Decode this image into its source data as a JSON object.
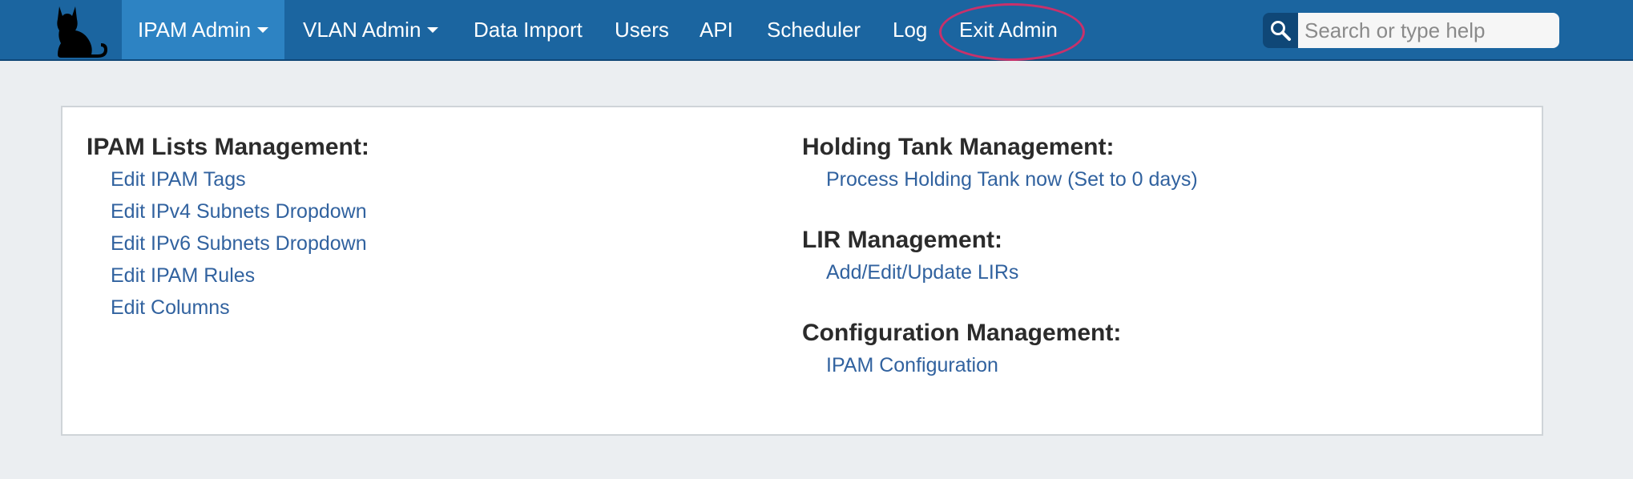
{
  "nav": {
    "items": [
      {
        "label": "IPAM Admin",
        "dropdown": true,
        "active": true
      },
      {
        "label": "VLAN Admin",
        "dropdown": true
      },
      {
        "label": "Data Import"
      },
      {
        "label": "Users"
      },
      {
        "label": "API"
      },
      {
        "label": "Scheduler"
      },
      {
        "label": "Log"
      },
      {
        "label": "Exit Admin",
        "highlighted": true
      }
    ],
    "search_placeholder": "Search or type help"
  },
  "colors": {
    "navbar": "#1b65a0",
    "nav_active": "#2d83c3",
    "link": "#31629f",
    "highlight_ring": "#c8316b",
    "page_bg": "#ebeef1"
  },
  "panel": {
    "left": {
      "sections": [
        {
          "title": "IPAM Lists Management:",
          "links": [
            "Edit IPAM Tags",
            "Edit IPv4 Subnets Dropdown",
            "Edit IPv6 Subnets Dropdown",
            "Edit IPAM Rules",
            "Edit Columns"
          ]
        }
      ]
    },
    "right": {
      "sections": [
        {
          "title": "Holding Tank Management:",
          "links": [
            "Process Holding Tank now (Set to 0 days)"
          ]
        },
        {
          "title": "LIR Management:",
          "links": [
            "Add/Edit/Update LIRs"
          ]
        },
        {
          "title": "Configuration Management:",
          "links": [
            "IPAM Configuration"
          ]
        }
      ]
    }
  }
}
